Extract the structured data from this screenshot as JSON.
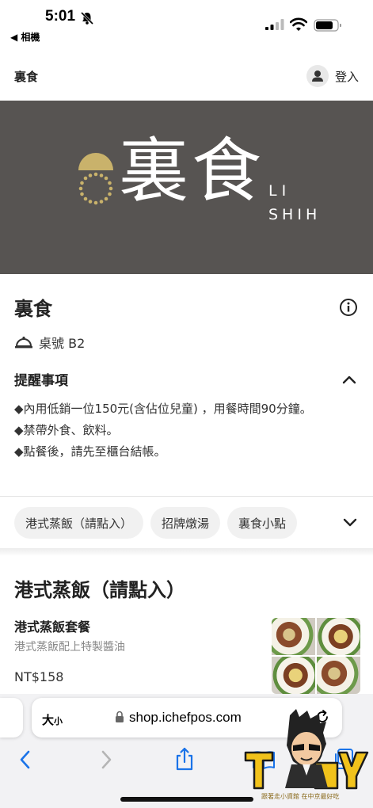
{
  "status_bar": {
    "time": "5:01",
    "back_app": "◀ 相機"
  },
  "header": {
    "store_name": "裏食",
    "login_label": "登入"
  },
  "banner": {
    "logo_text": "裏食",
    "logo_en_line1": "LI",
    "logo_en_line2": "SHIH"
  },
  "store": {
    "title": "裏食",
    "table_label": "桌號 B2",
    "notice_title": "提醒事項",
    "notice_lines": [
      "◆內用低銷一位150元(含佔位兒童) ，用餐時間90分鐘。",
      "◆禁帶外食、飲料。",
      "◆點餐後，請先至櫃台結帳。"
    ]
  },
  "tabs": [
    {
      "label": "港式蒸飯（請點入）"
    },
    {
      "label": "招牌燉湯"
    },
    {
      "label": "裏食小點"
    }
  ],
  "section": {
    "title": "港式蒸飯（請點入）",
    "items": [
      {
        "name": "港式蒸飯套餐",
        "desc": "港式蒸飯配上特製醬油",
        "price": "NT$158"
      }
    ]
  },
  "browser": {
    "text_size_big": "大",
    "text_size_small": "小",
    "url": "shop.ichefpos.com"
  },
  "watermark": {
    "text": "跟著走小資館 在中京最好吃"
  }
}
